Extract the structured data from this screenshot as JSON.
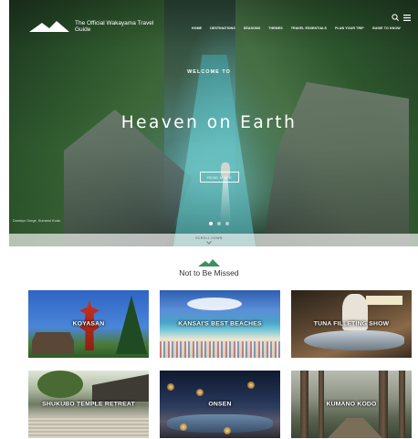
{
  "header": {
    "logo_text": "The Official Wakayama Travel Guide",
    "nav": [
      "HOME",
      "DESTINATIONS",
      "SEASONS",
      "THEMES",
      "TRAVEL ESSENTIALS",
      "PLAN YOUR TRIP",
      "GUIDE TO KNOW"
    ],
    "icons": [
      "search-icon",
      "menu-icon"
    ]
  },
  "hero": {
    "welcome": "WELCOME TO",
    "headline": "Heaven on Earth",
    "button_label": "READ MORE",
    "caption": "Dorokyo Gorge, Kumano Kodo",
    "slides_total": 3,
    "active_slide": 1,
    "scroll_label": "SCROLL DOWN"
  },
  "section": {
    "title": "Not to Be Missed",
    "tiles": [
      {
        "label": "KOYASAN"
      },
      {
        "label": "KANSAI'S BEST BEACHES"
      },
      {
        "label": "TUNA FILLETING SHOW"
      },
      {
        "label": "SHUKUBO TEMPLE RETREAT"
      },
      {
        "label": "ONSEN"
      },
      {
        "label": "KUMANO KODO"
      }
    ]
  },
  "colors": {
    "white": "#ffffff",
    "title_text": "#333333",
    "accent_green": "#3d8f5f"
  }
}
